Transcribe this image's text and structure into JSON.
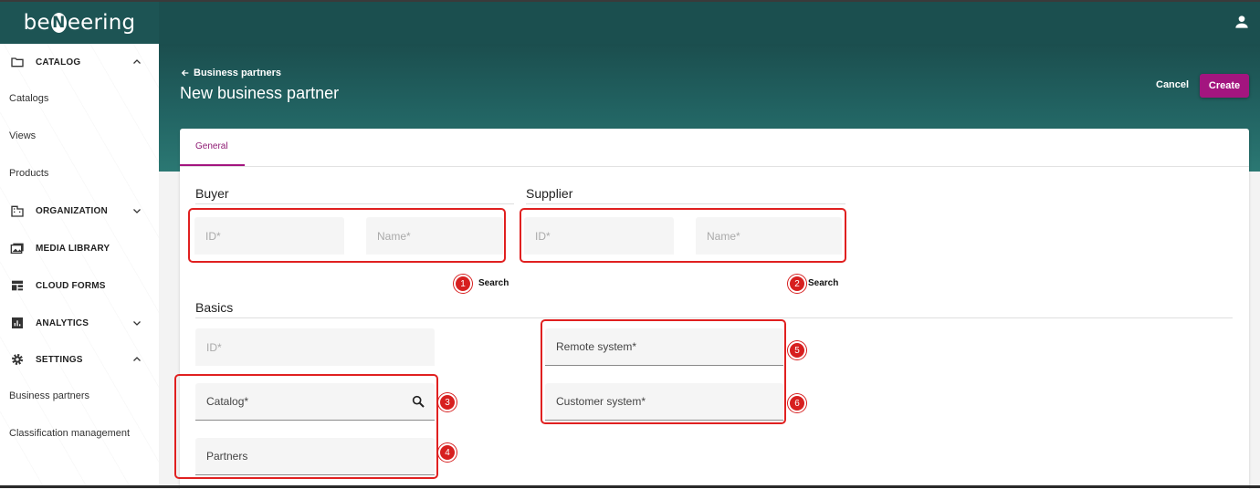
{
  "app": {
    "logo_text_left": "be",
    "logo_n": "N",
    "logo_text_right": "eering"
  },
  "sidebar": {
    "sections": [
      {
        "label": "CATALOG",
        "icon": "folder-icon",
        "expanded": true
      },
      {
        "label": "ORGANIZATION",
        "icon": "building-icon",
        "expanded": false
      },
      {
        "label": "MEDIA LIBRARY",
        "icon": "media-library-icon"
      },
      {
        "label": "CLOUD FORMS",
        "icon": "cloud-forms-icon"
      },
      {
        "label": "ANALYTICS",
        "icon": "analytics-icon",
        "expanded": false
      },
      {
        "label": "SETTINGS",
        "icon": "gear-icon",
        "expanded": true
      }
    ],
    "catalog_items": [
      "Catalogs",
      "Views",
      "Products"
    ],
    "settings_items": [
      "Business partners",
      "Classification management"
    ]
  },
  "header": {
    "back_label": "Business partners",
    "title": "New business partner",
    "cancel_label": "Cancel",
    "create_label": "Create"
  },
  "tabs": [
    {
      "label": "General",
      "active": true
    }
  ],
  "buyer": {
    "title": "Buyer",
    "id_placeholder": "ID*",
    "name_placeholder": "Name*",
    "search_label": "Search",
    "badge": "1"
  },
  "supplier": {
    "title": "Supplier",
    "id_placeholder": "ID*",
    "name_placeholder": "Name*",
    "search_label": "Search",
    "badge": "2"
  },
  "basics": {
    "title": "Basics",
    "id_placeholder": "ID*",
    "catalog_placeholder": "Catalog*",
    "partners_placeholder": "Partners",
    "remote_system_placeholder": "Remote system*",
    "customer_system_placeholder": "Customer system*",
    "badges": {
      "catalog": "3",
      "partners": "4",
      "remote": "5",
      "customer": "6"
    }
  },
  "colors": {
    "header_bg": "#1b4f4f",
    "accent": "#a3157f",
    "highlight": "#e02020"
  }
}
